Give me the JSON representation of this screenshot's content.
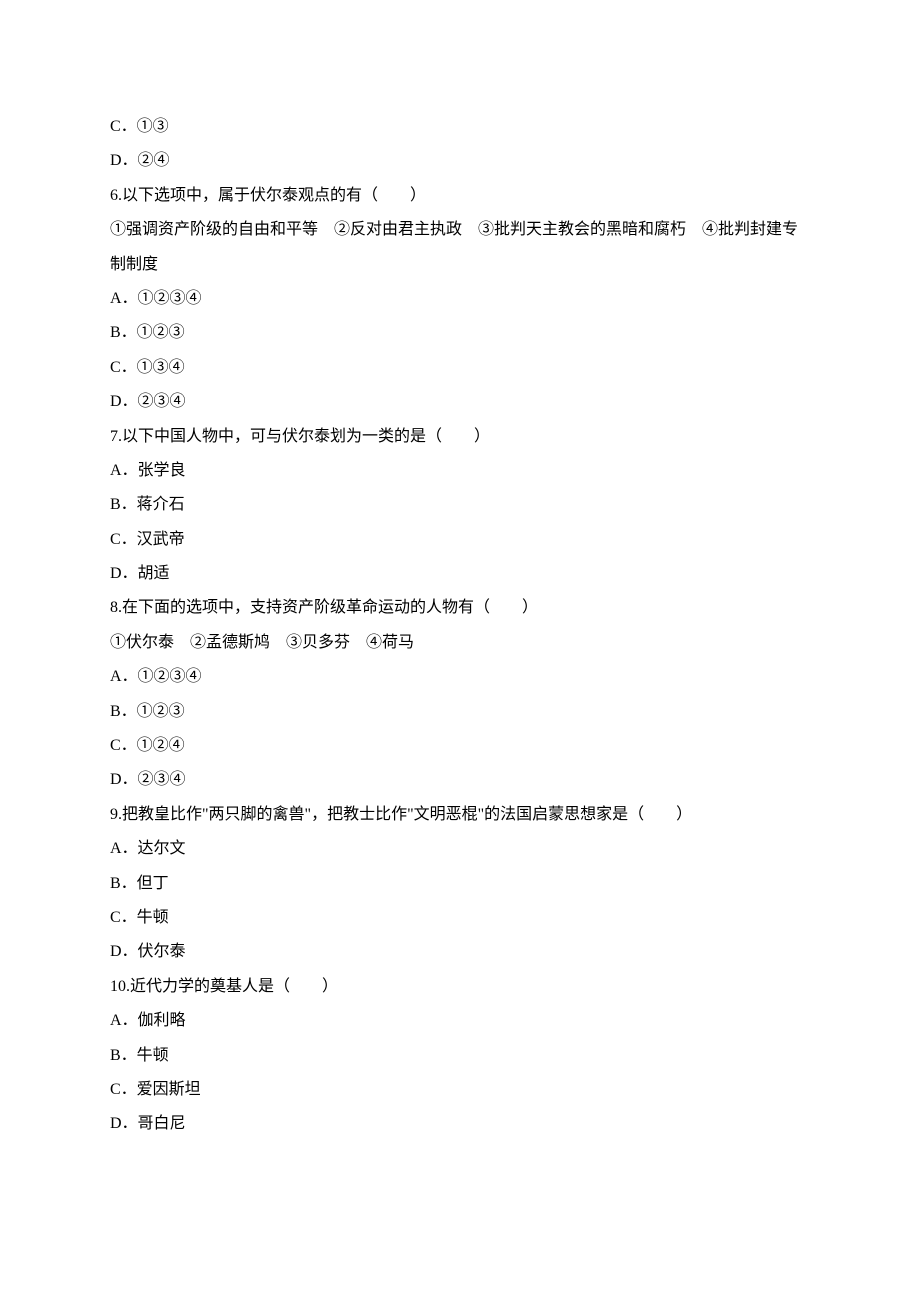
{
  "lines": [
    "C．①③",
    "D．②④",
    "6.以下选项中，属于伏尔泰观点的有（　　）",
    "①强调资产阶级的自由和平等　②反对由君主执政　③批判天主教会的黑暗和腐朽　④批判封建专制制度",
    "A．①②③④",
    "B．①②③",
    "C．①③④",
    "D．②③④",
    "7.以下中国人物中，可与伏尔泰划为一类的是（　　）",
    "A．张学良",
    "B．蒋介石",
    "C．汉武帝",
    "D．胡适",
    "8.在下面的选项中，支持资产阶级革命运动的人物有（　　）",
    "①伏尔泰　②孟德斯鸠　③贝多芬　④荷马",
    "A．①②③④",
    "B．①②③",
    "C．①②④",
    "D．②③④",
    "9.把教皇比作\"两只脚的禽兽\"，把教士比作\"文明恶棍\"的法国启蒙思想家是（　　）",
    "A．达尔文",
    "B．但丁",
    "C．牛顿",
    "D．伏尔泰",
    "10.近代力学的奠基人是（　　）",
    "A．伽利略",
    "B．牛顿",
    "C．爱因斯坦",
    "D．哥白尼"
  ]
}
